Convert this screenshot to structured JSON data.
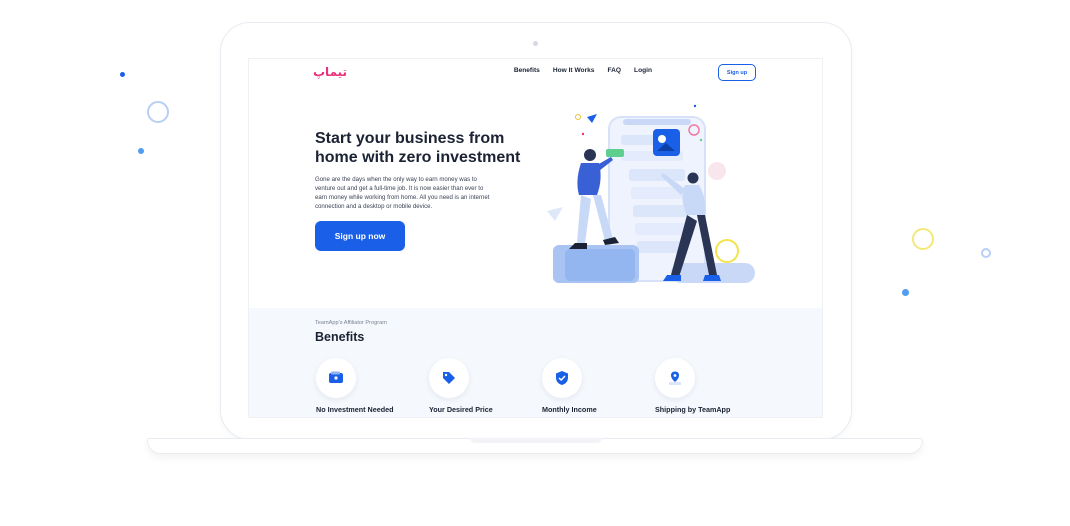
{
  "nav": {
    "logo_text": "تیماپ",
    "links": [
      "Benefits",
      "How It Works",
      "FAQ",
      "Login"
    ],
    "signup_label": "Sign up"
  },
  "hero": {
    "title": "Start your business from home with zero investment",
    "description": "Gone are the days when the only way to earn money was to venture out and get a full-time job. It is now easier than ever to earn money while working from home. All you need is an internet connection and a desktop or mobile device.",
    "cta_label": "Sign up now"
  },
  "benefits": {
    "eyebrow": "TeamApp's Affiliator Program",
    "title": "Benefits",
    "items": [
      {
        "label": "No Investment Needed",
        "icon": "wallet-icon"
      },
      {
        "label": "Your Desired Price",
        "icon": "price-tag-icon"
      },
      {
        "label": "Monthly Income",
        "icon": "shield-check-icon"
      },
      {
        "label": "Shipping by TeamApp",
        "icon": "location-pin-icon"
      }
    ]
  },
  "colors": {
    "accent": "#1a5fe8",
    "logo": "#e8307b",
    "text": "#1b2233",
    "section_bg": "#f5f8fc"
  }
}
